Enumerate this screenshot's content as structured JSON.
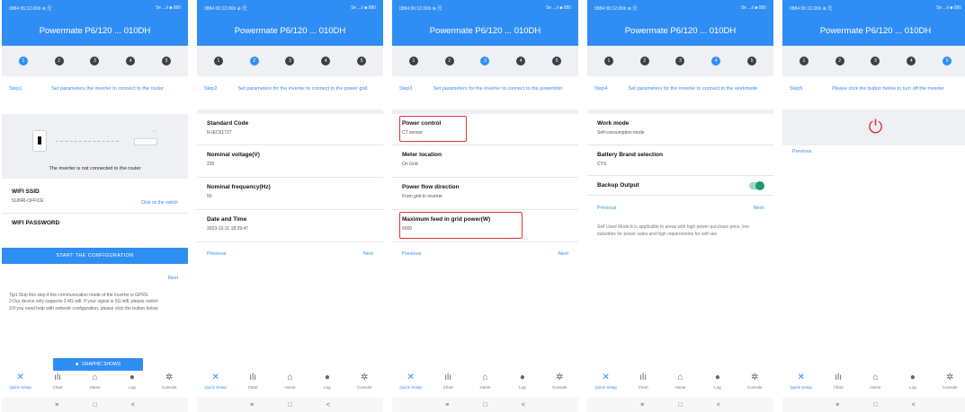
{
  "app": {
    "title": "Powermate P6/120 ... 010DH",
    "status_left": "0884 06:12.0Kb ⊕ 兄",
    "status_right": "5ʀ ...ıl ■ 080"
  },
  "steps": [
    "1",
    "2",
    "3",
    "4",
    "5"
  ],
  "bottom_nav": [
    {
      "icon": "✕",
      "label": "Quick Setup"
    },
    {
      "icon": "ılı",
      "label": "Chart"
    },
    {
      "icon": "⌂",
      "label": "Home"
    },
    {
      "icon": "●",
      "label": "Log"
    },
    {
      "icon": "✲",
      "label": "Console"
    }
  ],
  "system_nav": {
    "menu": "≡",
    "home": "□",
    "back": "<"
  },
  "common": {
    "previous": "Previous",
    "next": "Next"
  },
  "screen1": {
    "step_label": "Step1",
    "step_text": "Set parameters the inverter to connect to the router",
    "router_caption": "The inverter is not connected to the router",
    "wifi_ssid_label": "WIFI SSID",
    "wifi_ssid_value": "SUNRI-OFFICE",
    "switch_link": "Click on the switch",
    "wifi_password_label": "WIFI PASSWORD",
    "start_button": "START THE CONFIGURATION",
    "tips": [
      "Tip1:Skip this step if the communication mode of the inverter is GPRS",
      "2:Our device only supports 2.4G wifi. If your signal is 5G wifi, please switch",
      "3:If you need help with network configuration, please click the button below"
    ],
    "graphic_button": "GRAPHIC SHOWS"
  },
  "screen2": {
    "step_label": "Step2",
    "step_text": "Set parameters for the inverter to connect to the power grid",
    "fields": [
      {
        "name": "Standard Code",
        "value": "N-IEC61727"
      },
      {
        "name": "Nominal voltage(V)",
        "value": "230"
      },
      {
        "name": "Nominal frequency(Hz)",
        "value": "50"
      },
      {
        "name": "Date and Time",
        "value": "2023-12-11 18:39:47"
      }
    ]
  },
  "screen3": {
    "step_label": "Step3",
    "step_text": "Set parameters for the inverter to connect to the powerlimit",
    "fields": [
      {
        "name": "Power control",
        "value": "CT sensor"
      },
      {
        "name": "Meter location",
        "value": "On Grid"
      },
      {
        "name": "Power flow direction",
        "value": "From grid to inverter"
      },
      {
        "name": "Maximum feed in grid power(W)",
        "value": "6000"
      }
    ]
  },
  "screen4": {
    "step_label": "Step4",
    "step_text": "Set parameters for the inverter to connect to the workmode",
    "fields": [
      {
        "name": "Work mode",
        "value": "Self-consumption mode"
      },
      {
        "name": "Battery Brand selection",
        "value": "CYS"
      }
    ],
    "backup_label": "Backup Output",
    "backup_on": true,
    "description": "Self Used Mode:It is applicable to areas with high power purchase price, low subsidies for power sales and high requirements for self use"
  },
  "screen5": {
    "step_label": "Step5",
    "step_text": "Please click the button below to turn off the inverter",
    "power_icon": "⏻"
  }
}
